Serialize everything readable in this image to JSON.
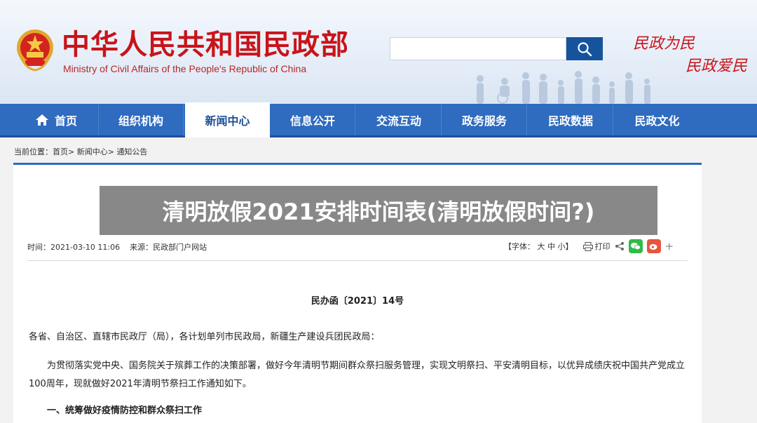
{
  "header": {
    "site_title": "中华人民共和国民政部",
    "site_subtitle": "Ministry of Civil Affairs of the People's Republic of China",
    "slogan_line1": "民政为民",
    "slogan_line2": "民政爱民",
    "emblem_icon": "national-emblem-icon",
    "search": {
      "placeholder": "",
      "value": "",
      "button_icon": "search-icon"
    }
  },
  "nav": {
    "items": [
      {
        "label": "首页",
        "icon": "home-icon"
      },
      {
        "label": "组织机构"
      },
      {
        "label": "新闻中心",
        "active": true
      },
      {
        "label": "信息公开"
      },
      {
        "label": "交流互动"
      },
      {
        "label": "政务服务"
      },
      {
        "label": "民政数据"
      },
      {
        "label": "民政文化"
      }
    ]
  },
  "breadcrumb": {
    "prefix": "当前位置：",
    "items": [
      "首页",
      "新闻中心",
      "通知公告"
    ],
    "separator": ">"
  },
  "article": {
    "meta_time_label": "时间：",
    "meta_time": "2021-03-10 11:06",
    "meta_source_label": "来源：",
    "meta_source": "民政部门户网站",
    "font_label": "【字体：",
    "font_large": "大",
    "font_medium": "中",
    "font_small": "小】",
    "print_label": "打印",
    "doc_number": "民办函〔2021〕14号",
    "paragraph_1": "各省、自治区、直辖市民政厅（局），各计划单列市民政局，新疆生产建设兵团民政局：",
    "paragraph_2": "为贯彻落实党中央、国务院关于殡葬工作的决策部署，做好今年清明节期间群众祭扫服务管理，实现文明祭扫、平安清明目标，以优异成绩庆祝中国共产党成立100周年，现就做好2021年清明节祭扫工作通知如下。",
    "paragraph_3": "一、统筹做好疫情防控和群众祭扫工作"
  },
  "overlay": {
    "title": "清明放假2021安排时间表(清明放假时间?)"
  },
  "colors": {
    "brand_red": "#c8141a",
    "nav_blue": "#2f6bbf",
    "search_blue": "#16539d"
  }
}
